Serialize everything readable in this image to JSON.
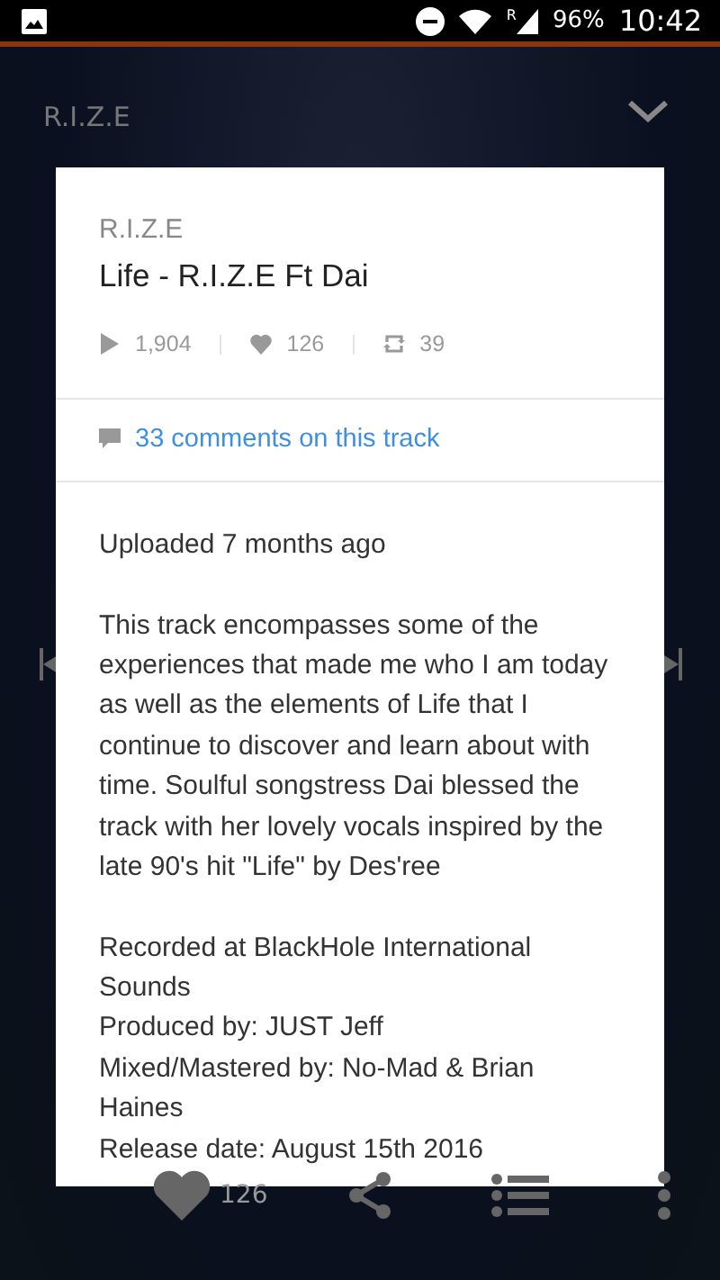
{
  "status_bar": {
    "battery": "96%",
    "network": "R",
    "time": "10:42"
  },
  "player": {
    "artist": "R.I.Z.E",
    "likes": "126"
  },
  "dialog": {
    "artist": "R.I.Z.E",
    "title": "Life - R.I.Z.E Ft Dai",
    "stats": [
      {
        "kind": "plays",
        "value": "1,904"
      },
      {
        "kind": "likes",
        "value": "126"
      },
      {
        "kind": "reposts",
        "value": "39"
      }
    ],
    "comments_link": "33 comments on this track",
    "paragraphs": [
      [
        "Uploaded 7 months ago"
      ],
      [
        "This track encompasses some of the experiences that made me who I am today as well as the elements of Life that I continue to discover and learn about with time. Soulful songstress Dai blessed the track with her lovely vocals inspired by the late 90's hit \"Life\" by Des'ree"
      ],
      [
        "Recorded at BlackHole International Sounds",
        "Produced by: JUST Jeff",
        "Mixed/Mastered by: No-Mad & Brian Haines",
        "Release date: August 15th 2016"
      ]
    ]
  }
}
